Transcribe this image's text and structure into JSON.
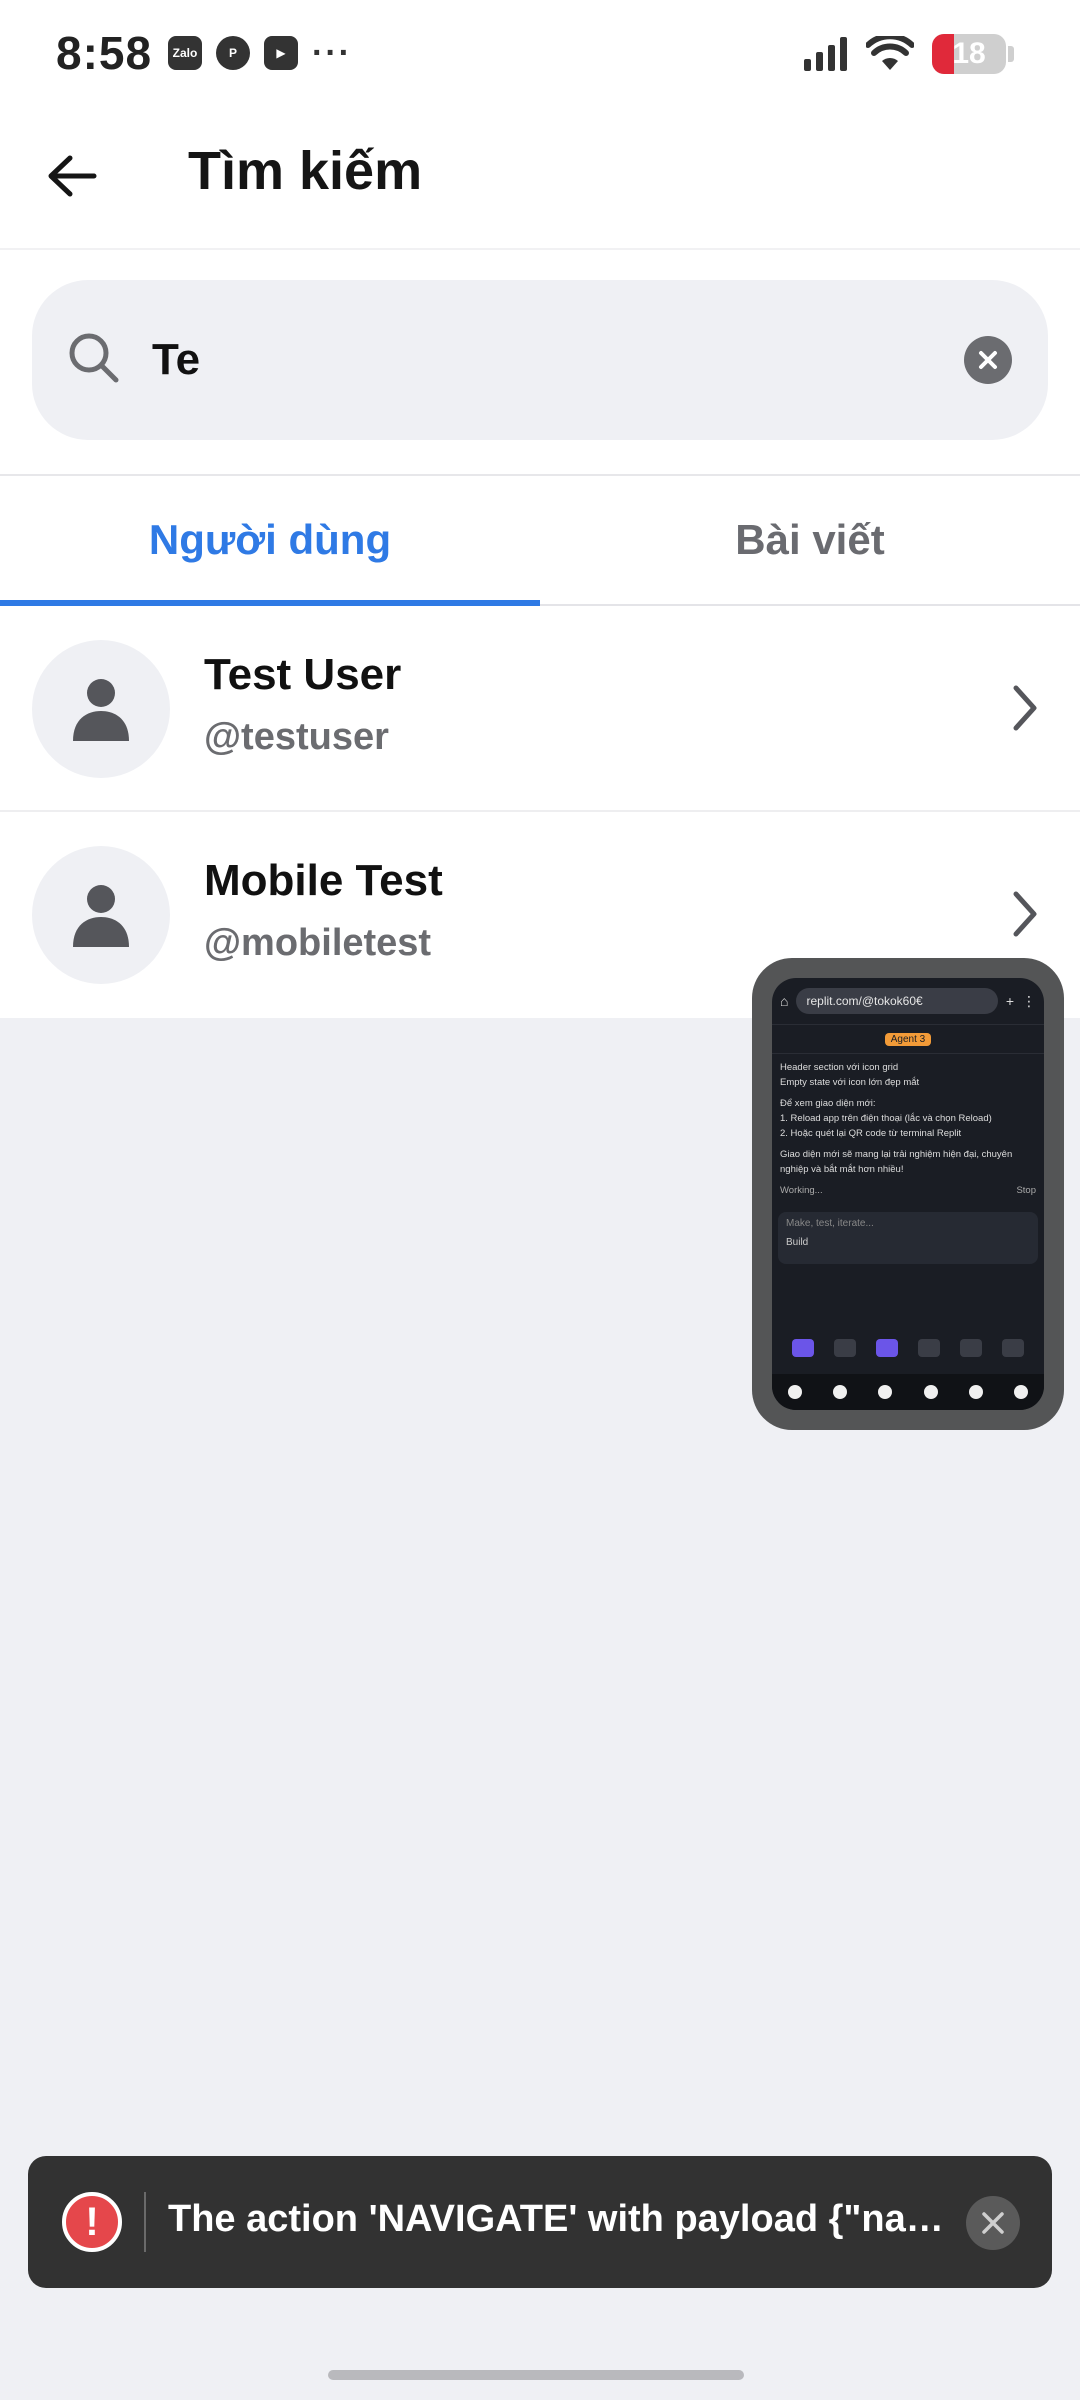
{
  "status_bar": {
    "time": "8:58",
    "notification_icons": [
      "zalo-icon",
      "pinterest-icon",
      "app-icon",
      "more-dots-icon"
    ],
    "zalo_label": "Zalo",
    "battery_percent": "18"
  },
  "header": {
    "title": "Tìm kiếm"
  },
  "search": {
    "value": "Te"
  },
  "tabs": [
    {
      "label": "Người dùng",
      "active": true
    },
    {
      "label": "Bài viết",
      "active": false
    }
  ],
  "results": [
    {
      "name": "Test User",
      "handle": "@testuser"
    },
    {
      "name": "Mobile Test",
      "handle": "@mobiletest"
    }
  ],
  "preview_window": {
    "url": "replit.com/@tokok60€",
    "badge": "Agent 3",
    "lines": [
      "Header section với icon grid",
      "Empty state với icon lớn đẹp mắt",
      "Để xem giao diện mới:",
      "1. Reload app trên điện thoại (lắc và chọn Reload)",
      "2. Hoặc quét lại QR code từ terminal Replit",
      "Giao diện mới sẽ mang lại trải nghiệm hiện đại, chuyên nghiệp và bắt mắt hơn nhiều!"
    ],
    "status": "Working...",
    "stop": "Stop",
    "input_placeholder": "Make, test, iterate...",
    "build_label": "Build"
  },
  "toast": {
    "message": "The action 'NAVIGATE' with payload {\"nam...",
    "color": "#e5474b"
  },
  "colors": {
    "accent": "#2f7ae5",
    "background": "#eff0f4"
  }
}
